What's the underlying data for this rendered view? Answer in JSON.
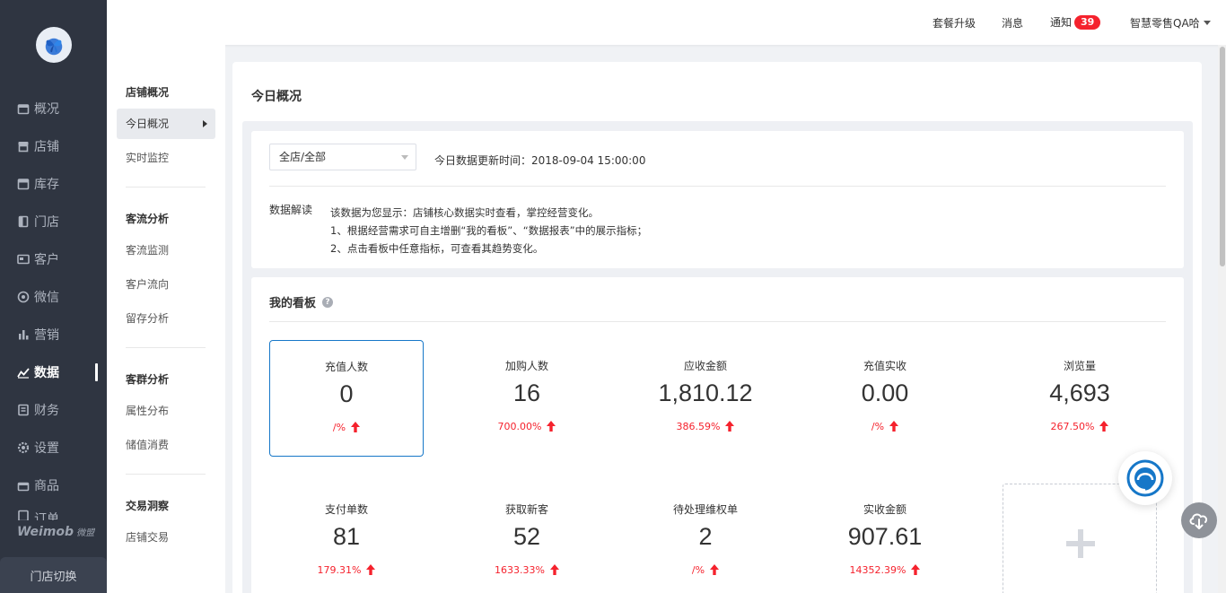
{
  "rail": {
    "items": [
      {
        "label": "概况",
        "icon": "calendar-icon"
      },
      {
        "label": "店铺",
        "icon": "shop-icon"
      },
      {
        "label": "库存",
        "icon": "box-icon"
      },
      {
        "label": "门店",
        "icon": "door-icon"
      },
      {
        "label": "客户",
        "icon": "id-card-icon"
      },
      {
        "label": "微信",
        "icon": "wechat-icon"
      },
      {
        "label": "营销",
        "icon": "bar-chart-icon"
      },
      {
        "label": "数据",
        "icon": "line-chart-icon"
      },
      {
        "label": "财务",
        "icon": "ledger-icon"
      },
      {
        "label": "设置",
        "icon": "gear-icon"
      },
      {
        "label": "商品",
        "icon": "bag-icon"
      },
      {
        "label": "订单",
        "icon": "order-icon"
      }
    ],
    "active_index": 7,
    "brand": "Weimob",
    "brand_cn": "微盟",
    "store_switch": "门店切换"
  },
  "topbar": {
    "upgrade": "套餐升级",
    "messages": "消息",
    "notify": "通知",
    "notify_count": "39",
    "account": "智慧零售QA哈"
  },
  "subnav": {
    "groups": [
      {
        "title": "店铺概况",
        "items": [
          "今日概况",
          "实时监控"
        ]
      },
      {
        "title": "客流分析",
        "items": [
          "客流监测",
          "客户流向",
          "留存分析"
        ]
      },
      {
        "title": "客群分析",
        "items": [
          "属性分布",
          "储值消费"
        ]
      },
      {
        "title": "交易洞察",
        "items": [
          "店铺交易"
        ]
      }
    ]
  },
  "main": {
    "title": "今日概况",
    "store_select": "全店/全部",
    "update_time": "今日数据更新时间：2018-09-04 15:00:00",
    "interp_label": "数据解读",
    "interp_lines": [
      "该数据为您显示：店铺核心数据实时查看，掌控经营变化。",
      "1、根据经营需求可自主增删“我的看板”、“数据报表”中的展示指标；",
      "2、点击看板中任意指标，可查看其趋势变化。"
    ],
    "board_title": "我的看板",
    "help_glyph": "?",
    "metrics": [
      {
        "label": "充值人数",
        "value": "0",
        "change": "/%"
      },
      {
        "label": "加购人数",
        "value": "16",
        "change": "700.00%"
      },
      {
        "label": "应收金额",
        "value": "1,810.12",
        "change": "386.59%"
      },
      {
        "label": "充值实收",
        "value": "0.00",
        "change": "/%"
      },
      {
        "label": "浏览量",
        "value": "4,693",
        "change": "267.50%"
      },
      {
        "label": "支付单数",
        "value": "81",
        "change": "179.31%"
      },
      {
        "label": "获取新客",
        "value": "52",
        "change": "1633.33%"
      },
      {
        "label": "待处理维权单",
        "value": "2",
        "change": "/%"
      },
      {
        "label": "实收金额",
        "value": "907.61",
        "change": "14352.39%"
      }
    ]
  },
  "colors": {
    "rail_bg": "#2f3541",
    "accent_blue": "#1677c8",
    "up_red": "#f5222d"
  }
}
